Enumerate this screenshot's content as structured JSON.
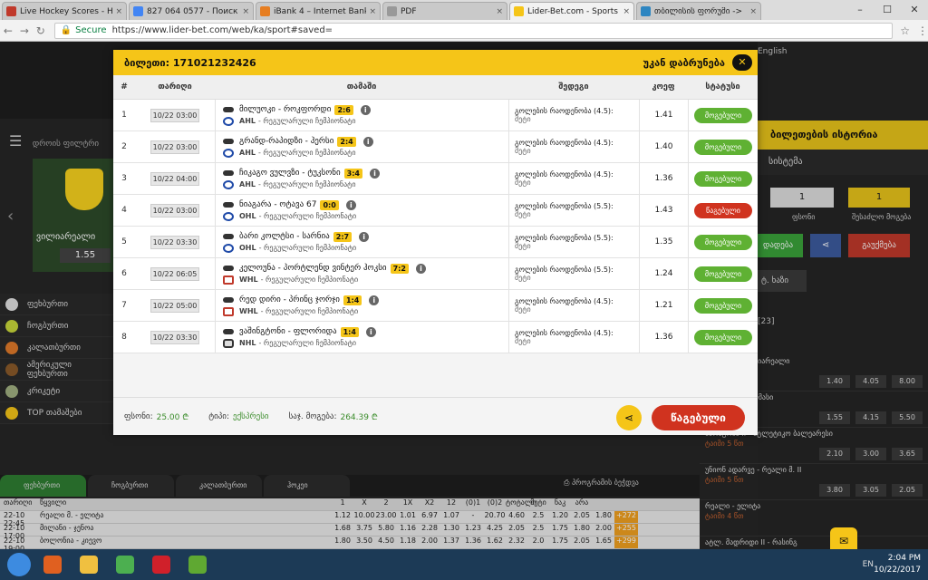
{
  "browser": {
    "tabs": [
      {
        "title": "Live Hockey Scores - Ho",
        "color": "#c0392b"
      },
      {
        "title": "827 064 0577 - Поиск в",
        "color": "#4285f4"
      },
      {
        "title": "iBank 4 – Internet Bankin",
        "color": "#e67e22"
      },
      {
        "title": "PDF",
        "color": "#999999"
      },
      {
        "title": "Lider-Bet.com - Sports a",
        "color": "#f5c518"
      },
      {
        "title": "თბილისის ფორუმი -> ",
        "color": "#2e86c1"
      }
    ],
    "secure_label": "Secure",
    "url": "https://www.lider-bet.com/web/ka/sport#saved="
  },
  "background": {
    "lang": "English",
    "nav_label": "დროის ფილტრი",
    "banner_label": "ვილიარეალი",
    "banner_odd": "1.55",
    "sports": [
      {
        "label": "ფეხბურთი",
        "color": "#e0e0e0"
      },
      {
        "label": "ჩოგბურთი",
        "color": "#c8d83a"
      },
      {
        "label": "კალათბურთი",
        "color": "#e07a2a"
      },
      {
        "label": "ამერიკული ფეხბურთი",
        "color": "#8a5a2a"
      },
      {
        "label": "კრიკეტი",
        "color": "#a0b080"
      },
      {
        "label": "TOP თამაშები",
        "color": "#f5c518"
      }
    ],
    "right": {
      "title": "ბილეთების ისტორია",
      "system_label": "სისტემა",
      "box1": "1",
      "box2": "1",
      "box1_label": "ფსონი",
      "box2_label": "შესაძლო მოგება",
      "green_btn": "დადება",
      "red_btn": "გაუქმება",
      "tab": "ტ. ხაზი",
      "count": "[23]",
      "events": [
        {
          "name": "ბორუსია - ვილიარეალი",
          "time": "15 წთ",
          "odds": [
            "1.40",
            "4.05",
            "8.00"
          ]
        },
        {
          "name": "ლო - ლას პალმასი",
          "time": "ტაიმი 5 წთ",
          "odds": [
            "1.55",
            "4.15",
            "5.50"
          ]
        },
        {
          "name": "სარაგოსა II - ატლეტიკო ბალეარესი",
          "time": "ტაიმი 5 წთ",
          "odds": [
            "2.10",
            "3.00",
            "3.65"
          ]
        },
        {
          "name": "უნიონ ადარვე - რეალი მ. II",
          "time": "ტაიმი 5 წთ",
          "odds": [
            "3.80",
            "3.05",
            "2.05"
          ]
        },
        {
          "name": "რეალი - ელიტა",
          "time": "ტაიმი 4 წთ",
          "odds": []
        },
        {
          "name": "ატლ. მადრიდი II - რასინგ",
          "time": "",
          "odds": []
        }
      ]
    },
    "bottom_tabs": [
      "ფეხბურთი",
      "ჩოგბურთი",
      "კალათბურთი",
      "ჰოკეი"
    ],
    "print_label": "პროგრამის ბეჭდვა",
    "grid_header": [
      "თარიღი",
      "წყვილი",
      "1",
      "X",
      "2",
      "1X",
      "X2",
      "12",
      "(0)1",
      "(0)2",
      "ტოტალი",
      "მეტი",
      "ნაკ",
      "არა"
    ],
    "grid_rows": [
      {
        "d": "22-10 22:45",
        "n": "რეალი მ. - ელიტა",
        "v": [
          "1.12",
          "10.00",
          "23.00",
          "1.01",
          "6.97",
          "1.07",
          "-",
          "20.70",
          "4.60",
          "2.5",
          "1.20",
          "2.05",
          "1.80"
        ],
        "p": "+272"
      },
      {
        "d": "22-10 17:00",
        "n": "მილანი - ჯენოა",
        "v": [
          "1.68",
          "3.75",
          "5.80",
          "1.16",
          "2.28",
          "1.30",
          "1.23",
          "4.25",
          "2.05",
          "2.5",
          "1.75",
          "1.80",
          "2.00"
        ],
        "p": "+255"
      },
      {
        "d": "22-10 19:00",
        "n": "ბოლონია - კიევო",
        "v": [
          "1.80",
          "3.50",
          "4.50",
          "1.18",
          "2.00",
          "1.37",
          "1.36",
          "1.62",
          "2.32",
          "2.0",
          "1.75",
          "2.05",
          "1.65"
        ],
        "p": "+299"
      }
    ]
  },
  "modal": {
    "title": "ბილეთი: 171021232426",
    "back": "უკან დაბრუნება",
    "headers": {
      "num": "#",
      "date": "თარიღი",
      "game": "თამაში",
      "outcome": "შედეგი",
      "coef": "კოეფ",
      "status": "სტატუსი"
    },
    "rows": [
      {
        "num": "1",
        "date": "10/22 03:00",
        "match": "მილუოკი - როკფორდი",
        "score": "2:6",
        "league": "AHL",
        "league_type": "ahl",
        "league_desc": "- რეგულარული ჩემპიონატი",
        "outcome": "გოლების რაოდენობა (4.5):",
        "sub": "მეტი",
        "coef": "1.41",
        "status": "მოგებული",
        "won": true
      },
      {
        "num": "2",
        "date": "10/22 03:00",
        "match": "გრანდ-რაპიდზი - ჰერსი",
        "score": "2:4",
        "league": "AHL",
        "league_type": "ahl",
        "league_desc": "- რეგულარული ჩემპიონატი",
        "outcome": "გოლების რაოდენობა (4.5):",
        "sub": "მეტი",
        "coef": "1.40",
        "status": "მოგებული",
        "won": true
      },
      {
        "num": "3",
        "date": "10/22 04:00",
        "match": "ჩიკაგო ვულვზი - ტუკსონი",
        "score": "3:4",
        "league": "AHL",
        "league_type": "ahl",
        "league_desc": "- რეგულარული ჩემპიონატი",
        "outcome": "გოლების რაოდენობა (4.5):",
        "sub": "მეტი",
        "coef": "1.36",
        "status": "მოგებული",
        "won": true
      },
      {
        "num": "4",
        "date": "10/22 03:00",
        "match": "ნიაგარა - ოტავა 67",
        "score": "0:0",
        "league": "OHL",
        "league_type": "ohl",
        "league_desc": "- რეგულარული ჩემპიონატი",
        "outcome": "გოლების რაოდენობა (5.5):",
        "sub": "მეტი",
        "coef": "1.43",
        "status": "წაგებული",
        "won": false
      },
      {
        "num": "5",
        "date": "10/22 03:30",
        "match": "ბარი კოლტსი - სარნია",
        "score": "2:7",
        "league": "OHL",
        "league_type": "ohl",
        "league_desc": "- რეგულარული ჩემპიონატი",
        "outcome": "გოლების რაოდენობა (5.5):",
        "sub": "მეტი",
        "coef": "1.35",
        "status": "მოგებული",
        "won": true
      },
      {
        "num": "6",
        "date": "10/22 06:05",
        "match": "კელოუნა - პორტლენდ ვინტერ ჰოკსი",
        "score": "7:2",
        "league": "WHL",
        "league_type": "whl",
        "league_desc": "- რეგულარული ჩემპიონატი",
        "outcome": "გოლების რაოდენობა (5.5):",
        "sub": "მეტი",
        "coef": "1.24",
        "status": "მოგებული",
        "won": true
      },
      {
        "num": "7",
        "date": "10/22 05:00",
        "match": "რედ დირი - პრინც ჯორჯი",
        "score": "1:4",
        "league": "WHL",
        "league_type": "whl",
        "league_desc": "- რეგულარული ჩემპიონატი",
        "outcome": "გოლების რაოდენობა (4.5):",
        "sub": "მეტი",
        "coef": "1.21",
        "status": "მოგებული",
        "won": true
      },
      {
        "num": "8",
        "date": "10/22 03:30",
        "match": "ვაშინგტონი - ფლორიდა",
        "score": "1:4",
        "league": "NHL",
        "league_type": "nhl",
        "league_desc": "- რეგულარული ჩემპიონატი",
        "outcome": "გოლების რაოდენობა (4.5):",
        "sub": "მეტი",
        "coef": "1.36",
        "status": "მოგებული",
        "won": true
      }
    ],
    "footer": {
      "stake_label": "ფსონი:",
      "stake": "25.00 ₾",
      "type_label": "ტიპი:",
      "type": "ექსპრესი",
      "total_label": "საჯ. მოგება:",
      "total": "264.39 ₾",
      "status_btn": "წაგებული"
    }
  },
  "taskbar": {
    "apps": [
      {
        "name": "media-player-icon",
        "color": "#e06020"
      },
      {
        "name": "file-explorer-icon",
        "color": "#f0c040"
      },
      {
        "name": "chrome-icon",
        "color": "#4caf50"
      },
      {
        "name": "opera-icon",
        "color": "#d0202a"
      },
      {
        "name": "utorrent-icon",
        "color": "#5fa832"
      }
    ],
    "tray": "EN",
    "time": "2:04 PM",
    "date": "10/22/2017"
  }
}
